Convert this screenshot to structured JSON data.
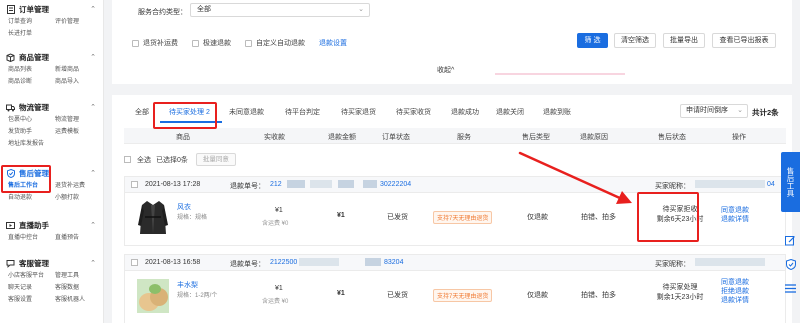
{
  "sidebar": {
    "groups": [
      {
        "title": "订单管理",
        "icon": "document-icon",
        "items": [
          "订单查询",
          "评价管理",
          "长进打单"
        ]
      },
      {
        "title": "商品管理",
        "icon": "box-icon",
        "items": [
          "商品列表",
          "新增商品",
          "商品诊断",
          "商品导入"
        ]
      },
      {
        "title": "物流管理",
        "icon": "truck-icon",
        "items": [
          "包裹中心",
          "物流管理",
          "发货助手",
          "运费模板",
          "地址库发报告"
        ]
      },
      {
        "title": "售后管理",
        "icon": "shield-icon",
        "items": [
          "售后工作台",
          "退货补运费",
          "自动退款",
          "小额打款"
        ]
      },
      {
        "title": "直播助手",
        "icon": "live-icon",
        "items": [
          "直播中控台",
          "直播预告"
        ]
      },
      {
        "title": "客服管理",
        "icon": "chat-icon",
        "items": [
          "小店客服平台",
          "管理工具",
          "聊天记录",
          "客服数据",
          "客服设置",
          "客服机器人"
        ]
      }
    ]
  },
  "filters": {
    "contract_label": "服务合约类型：",
    "contract_value": "全部",
    "checkboxes": [
      "退货补运费",
      "极速退款",
      "自定义自动退款"
    ],
    "refund_settings_link": "退款设置",
    "buttons": {
      "filter": "筛 选",
      "clear": "清空筛选",
      "batch_export": "批量导出",
      "view_export": "查看已导出报表"
    },
    "collapse": "收起^"
  },
  "tabs": [
    "全部",
    "待买家处理 2",
    "未同意退款",
    "待平台判定",
    "待买家退货",
    "待买家收货",
    "退款成功",
    "退款关闭",
    "退款到账"
  ],
  "sort": {
    "value": "申请时间倒序"
  },
  "total": "共计2条",
  "table_headers": [
    "商品",
    "实收款",
    "退款金额",
    "订单状态",
    "服务",
    "售后类型",
    "退款原因",
    "售后状态",
    "操作"
  ],
  "select_all": {
    "label": "全选",
    "selected": "已选择0条",
    "batch_button": "批量同意"
  },
  "orders": [
    {
      "date": "2021-08-13 17:28",
      "refund_label": "退款单号：",
      "refund_no_prefix": "212",
      "refund_no_suffix": "30222204",
      "buyer_label": "买家昵称：",
      "buyer_suffix": "04",
      "product_name": "风衣",
      "product_spec": "规格：规格",
      "paid": "¥1",
      "paid_sub": "含运费 ¥0",
      "refund_amount": "¥1",
      "order_status": "已发货",
      "service_tag": "支持7天无理由退货",
      "after_type": "仅退款",
      "reason": "拍错、拍多",
      "status": "待买家拒收\n剩余6天23小时",
      "actions": [
        "同意退款",
        "退款详情"
      ]
    },
    {
      "date": "2021-08-13 16:58",
      "refund_label": "退款单号：",
      "refund_no_prefix": "2122500",
      "refund_no_suffix": "83204",
      "buyer_label": "买家昵称：",
      "buyer_suffix": "",
      "product_name": "丰水梨",
      "product_spec": "规格：1-2两/个",
      "paid": "¥1",
      "paid_sub": "含运费 ¥0",
      "refund_amount": "¥1",
      "order_status": "已发货",
      "service_tag": "支持7天无理由退货",
      "after_type": "仅退款",
      "reason": "拍错、拍多",
      "status": "待买家处理\n剩余1天23小时",
      "actions": [
        "同意退款",
        "拒绝退款",
        "退款详情"
      ]
    }
  ],
  "right_tools": {
    "label": "售后工具"
  },
  "colors": {
    "accent": "#1a6de0",
    "highlight": "#e8201e",
    "service_tag": "#f07b34"
  }
}
